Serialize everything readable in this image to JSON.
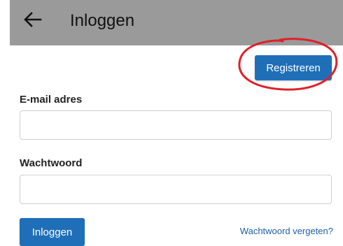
{
  "appbar": {
    "title": "Inloggen",
    "back_icon": "arrow-left-icon",
    "background_color": "#9a9a9a"
  },
  "register_button": {
    "label": "Registreren",
    "color": "#1f6fb8"
  },
  "annotation": {
    "shape": "hand-drawn circle",
    "color": "#e0202a"
  },
  "form": {
    "email_label": "E-mail adres",
    "email_value": "",
    "password_label": "Wachtwoord",
    "password_value": "",
    "login_label": "Inloggen",
    "forgot_password_label": "Wachtwoord vergeten?"
  }
}
